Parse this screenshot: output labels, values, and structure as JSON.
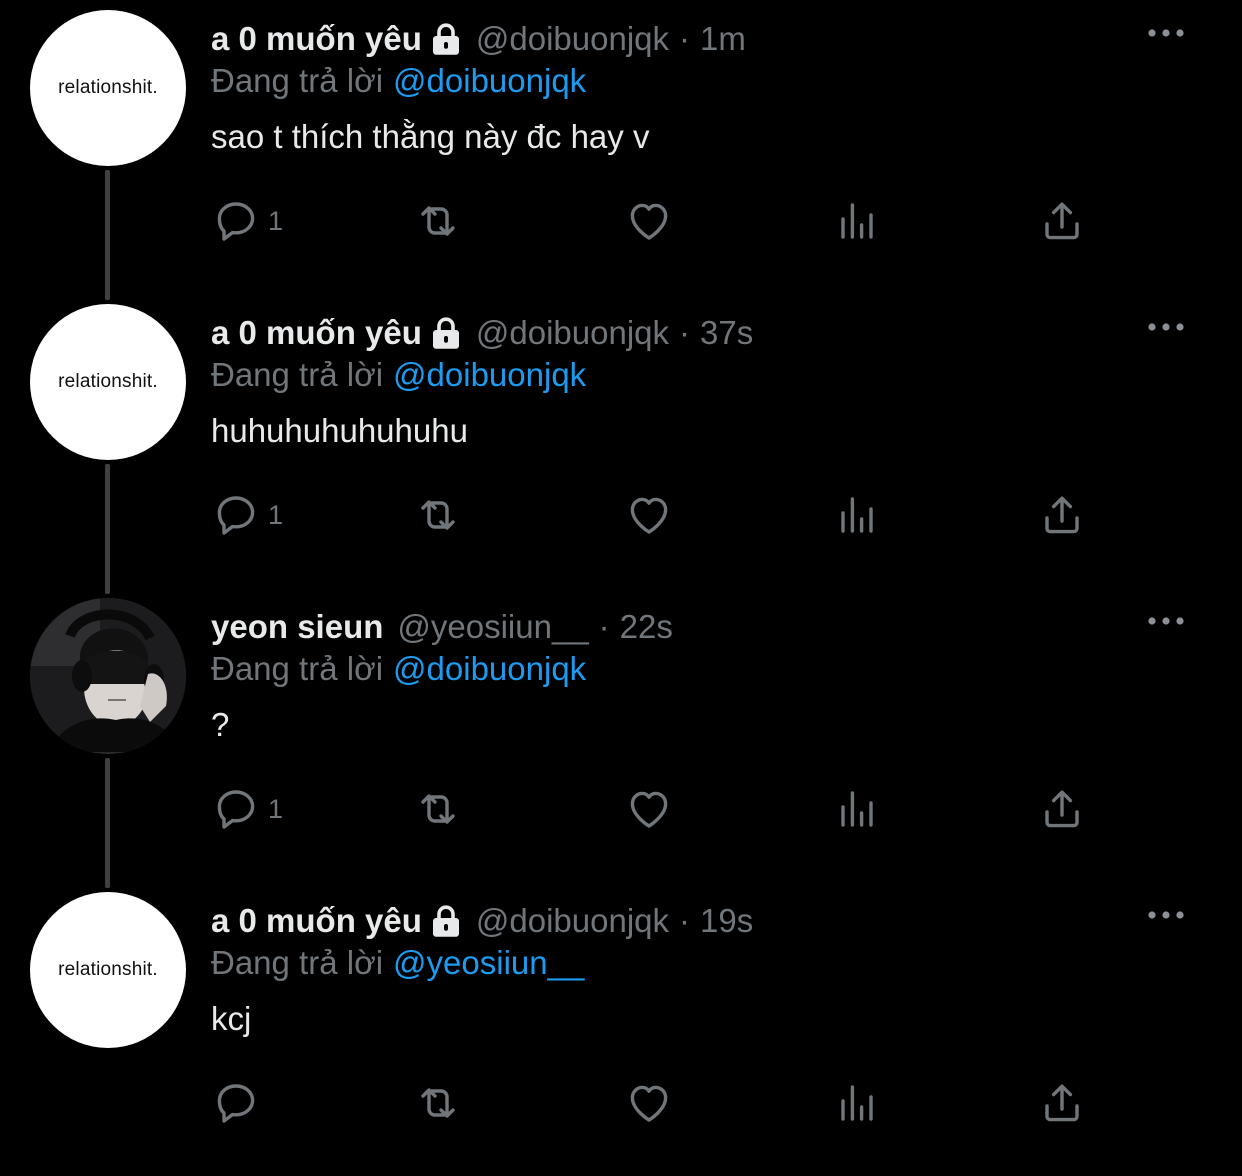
{
  "colors": {
    "background": "#000000",
    "primary_text": "#e7e9ea",
    "secondary_text": "#71767b",
    "accent": "#1d9bf0",
    "thread_line": "#3e4144"
  },
  "tweets": [
    {
      "avatar_text": "relationshit.",
      "display_name": "a 0 muốn yêu",
      "protected": true,
      "handle": "@doibuonjqk",
      "separator": "·",
      "time": "1m",
      "reply_prefix": "Đang trả lời",
      "reply_mention": "@doibuonjqk",
      "text": "sao t thích thằng này đc hay v",
      "reply_count": "1",
      "icons": [
        "reply-icon",
        "retweet-icon",
        "like-icon",
        "views-icon",
        "share-icon"
      ]
    },
    {
      "avatar_text": "relationshit.",
      "display_name": "a 0 muốn yêu",
      "protected": true,
      "handle": "@doibuonjqk",
      "separator": "·",
      "time": "37s",
      "reply_prefix": "Đang trả lời",
      "reply_mention": "@doibuonjqk",
      "text": "huhuhuhuhuhuhu",
      "reply_count": "1",
      "icons": [
        "reply-icon",
        "retweet-icon",
        "like-icon",
        "views-icon",
        "share-icon"
      ]
    },
    {
      "avatar_text": "",
      "display_name": "yeon sieun",
      "protected": false,
      "handle": "@yeosiiun__",
      "separator": "·",
      "time": "22s",
      "reply_prefix": "Đang trả lời",
      "reply_mention": "@doibuonjqk",
      "text": "?",
      "reply_count": "1",
      "icons": [
        "reply-icon",
        "retweet-icon",
        "like-icon",
        "views-icon",
        "share-icon"
      ]
    },
    {
      "avatar_text": "relationshit.",
      "display_name": "a 0 muốn yêu",
      "protected": true,
      "handle": "@doibuonjqk",
      "separator": "·",
      "time": "19s",
      "reply_prefix": "Đang trả lời",
      "reply_mention": "@yeosiiun__",
      "text": "kcj",
      "reply_count": "",
      "icons": [
        "reply-icon",
        "retweet-icon",
        "like-icon",
        "views-icon",
        "share-icon"
      ]
    }
  ]
}
